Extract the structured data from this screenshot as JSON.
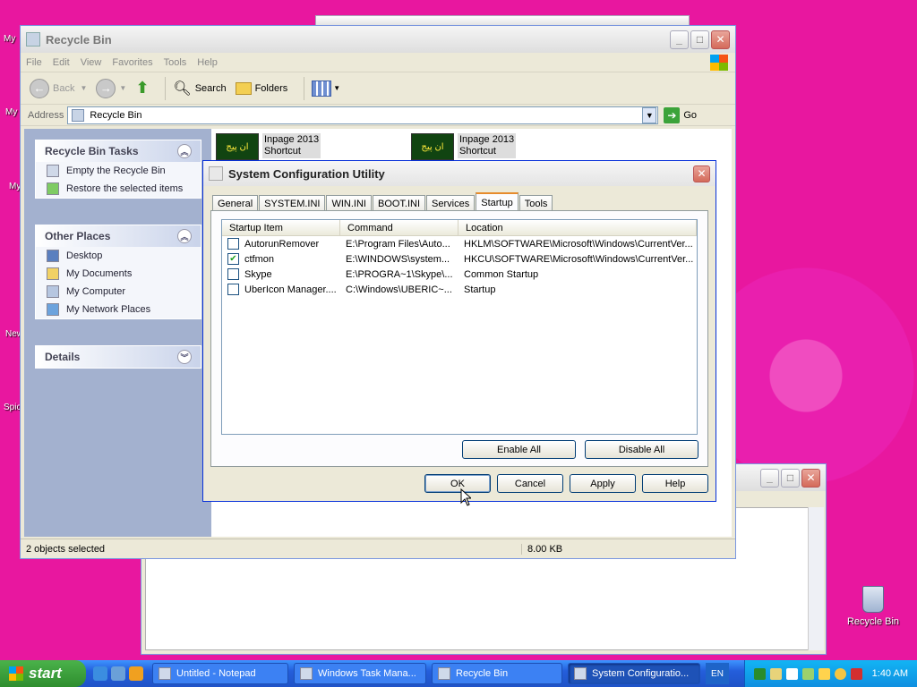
{
  "desktop": {
    "labels": [
      "My",
      "My",
      "My",
      "New",
      "Spic"
    ],
    "recycle_bin_label": "Recycle Bin"
  },
  "recycle_bin_window": {
    "title": "Recycle Bin",
    "menu": [
      "File",
      "Edit",
      "View",
      "Favorites",
      "Tools",
      "Help"
    ],
    "toolbar": {
      "back": "Back",
      "search": "Search",
      "folders": "Folders"
    },
    "address": {
      "label": "Address",
      "value": "Recycle Bin",
      "go": "Go"
    },
    "tasks": {
      "title": "Recycle Bin Tasks",
      "items": [
        "Empty the Recycle Bin",
        "Restore the selected items"
      ]
    },
    "other_places": {
      "title": "Other Places",
      "items": [
        "Desktop",
        "My Documents",
        "My Computer",
        "My Network Places"
      ]
    },
    "details": {
      "title": "Details"
    },
    "files": [
      {
        "name": "Inpage 2013",
        "type": "Shortcut",
        "thumb_text": "ان پیج"
      },
      {
        "name": "Inpage 2013",
        "type": "Shortcut",
        "thumb_text": "ان پیج"
      }
    ],
    "status": {
      "selected": "2 objects selected",
      "size": "8.00 KB"
    }
  },
  "sysconfig": {
    "title": "System Configuration Utility",
    "tabs": [
      "General",
      "SYSTEM.INI",
      "WIN.INI",
      "BOOT.INI",
      "Services",
      "Startup",
      "Tools"
    ],
    "active_tab": "Startup",
    "columns": [
      "Startup Item",
      "Command",
      "Location"
    ],
    "rows": [
      {
        "checked": false,
        "item": "AutorunRemover",
        "command": "E:\\Program Files\\Auto...",
        "location": "HKLM\\SOFTWARE\\Microsoft\\Windows\\CurrentVer..."
      },
      {
        "checked": true,
        "item": "ctfmon",
        "command": "E:\\WINDOWS\\system...",
        "location": "HKCU\\SOFTWARE\\Microsoft\\Windows\\CurrentVer..."
      },
      {
        "checked": false,
        "item": "Skype",
        "command": "E:\\PROGRA~1\\Skype\\...",
        "location": "Common Startup"
      },
      {
        "checked": false,
        "item": "UberIcon Manager....",
        "command": "C:\\Windows\\UBERIC~...",
        "location": "Startup"
      }
    ],
    "buttons": {
      "enable_all": "Enable All",
      "disable_all": "Disable All",
      "ok": "OK",
      "cancel": "Cancel",
      "apply": "Apply",
      "help": "Help"
    }
  },
  "taskbar": {
    "start": "start",
    "tasks": [
      "Untitled - Notepad",
      "Windows Task Mana...",
      "Recycle Bin",
      "System Configuratio..."
    ],
    "active_task": "System Configuratio...",
    "language": "EN",
    "clock": "1:40 AM"
  }
}
